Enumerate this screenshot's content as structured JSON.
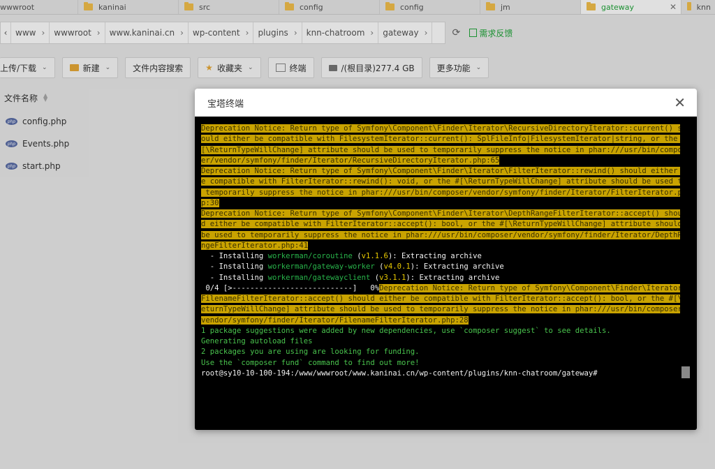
{
  "tabs": [
    {
      "label": "wwwroot",
      "active": false
    },
    {
      "label": "kaninai",
      "active": false
    },
    {
      "label": "src",
      "active": false
    },
    {
      "label": "config",
      "active": false
    },
    {
      "label": "config",
      "active": false
    },
    {
      "label": "jm",
      "active": false
    },
    {
      "label": "gateway",
      "active": true
    },
    {
      "label": "knn",
      "active": false
    }
  ],
  "breadcrumb": [
    "www",
    "wwwroot",
    "www.kaninai.cn",
    "wp-content",
    "plugins",
    "knn-chatroom",
    "gateway"
  ],
  "feedback_label": "需求反馈",
  "toolbar": {
    "upload_label": "上传/下载",
    "new_label": "新建",
    "search_label": "文件内容搜索",
    "favorites_label": "收藏夹",
    "terminal_label": "终端",
    "disk_label": "/(根目录)277.4 GB",
    "more_label": "更多功能"
  },
  "file_list": {
    "header": "文件名称",
    "files": [
      "config.php",
      "Events.php",
      "start.php"
    ]
  },
  "dialog": {
    "title": "宝塔终端",
    "lines": [
      [
        {
          "t": "Deprecation Notice: Return type of Symfony\\Component\\Finder\\Iterator\\RecursiveDirectoryIterator::current() sh",
          "c": "hl"
        }
      ],
      [
        {
          "t": "ould either be compatible with FilesystemIterator::current(): SplFileInfo|FilesystemIterator|string, or the #",
          "c": "hl"
        }
      ],
      [
        {
          "t": "[\\ReturnTypeWillChange] attribute should be used to temporarily suppress the notice in phar:///usr/bin/compos",
          "c": "hl"
        }
      ],
      [
        {
          "t": "er/vendor/symfony/finder/Iterator/RecursiveDirectoryIterator.php:65",
          "c": "hl"
        }
      ],
      [
        {
          "t": "Deprecation Notice: Return type of Symfony\\Component\\Finder\\Iterator\\FilterIterator::rewind() should either b",
          "c": "hl"
        }
      ],
      [
        {
          "t": "e compatible with FilterIterator::rewind(): void, or the #[\\ReturnTypeWillChange] attribute should be used to",
          "c": "hl"
        }
      ],
      [
        {
          "t": " temporarily suppress the notice in phar:///usr/bin/composer/vendor/symfony/finder/Iterator/FilterIterator.ph",
          "c": "hl"
        }
      ],
      [
        {
          "t": "p:30",
          "c": "hl"
        }
      ],
      [
        {
          "t": "Deprecation Notice: Return type of Symfony\\Component\\Finder\\Iterator\\DepthRangeFilterIterator::accept() shoul",
          "c": "hl"
        }
      ],
      [
        {
          "t": "d either be compatible with FilterIterator::accept(): bool, or the #[\\ReturnTypeWillChange] attribute should ",
          "c": "hl"
        }
      ],
      [
        {
          "t": "be used to temporarily suppress the notice in phar:///usr/bin/composer/vendor/symfony/finder/Iterator/DepthRa",
          "c": "hl"
        }
      ],
      [
        {
          "t": "ngeFilterIterator.php:41",
          "c": "hl"
        }
      ],
      [
        {
          "t": "  - Installing ",
          "c": "w"
        },
        {
          "t": "workerman/coroutine",
          "c": "pk"
        },
        {
          "t": " (",
          "c": "w"
        },
        {
          "t": "v1.1.6",
          "c": "vr"
        },
        {
          "t": "): Extracting archive",
          "c": "w"
        }
      ],
      [
        {
          "t": "  - Installing ",
          "c": "w"
        },
        {
          "t": "workerman/gateway-worker",
          "c": "pk"
        },
        {
          "t": " (",
          "c": "w"
        },
        {
          "t": "v4.0.1",
          "c": "vr"
        },
        {
          "t": "): Extracting archive",
          "c": "w"
        }
      ],
      [
        {
          "t": "  - Installing ",
          "c": "w"
        },
        {
          "t": "workerman/gatewayclient",
          "c": "pk"
        },
        {
          "t": " (",
          "c": "w"
        },
        {
          "t": "v3.1.1",
          "c": "vr"
        },
        {
          "t": "): Extracting archive",
          "c": "w"
        }
      ],
      [
        {
          "t": " 0/4 [>---------------------------]   0%",
          "c": "w"
        },
        {
          "t": "Deprecation Notice: Return type of Symfony\\Component\\Finder\\Iterator\\",
          "c": "hl"
        }
      ],
      [
        {
          "t": "FilenameFilterIterator::accept() should either be compatible with FilterIterator::accept(): bool, or the #[\\R",
          "c": "hl"
        }
      ],
      [
        {
          "t": "eturnTypeWillChange] attribute should be used to temporarily suppress the notice in phar:///usr/bin/composer/",
          "c": "hl"
        }
      ],
      [
        {
          "t": "vendor/symfony/finder/Iterator/FilenameFilterIterator.php:28",
          "c": "hl"
        }
      ],
      [
        {
          "t": "1 package suggestions were added by new dependencies, use `composer suggest` to see details.",
          "c": "g"
        }
      ],
      [
        {
          "t": "Generating autoload files",
          "c": "g"
        }
      ],
      [
        {
          "t": "2 packages you are using are looking for funding.",
          "c": "g"
        }
      ],
      [
        {
          "t": "Use the `composer fund` command to find out more!",
          "c": "g"
        }
      ],
      [
        {
          "t": "root@sy10-10-100-194:/www/wwwroot/www.kaninai.cn/wp-content/plugins/knn-chatroom/gateway# ",
          "c": "w"
        }
      ]
    ]
  }
}
